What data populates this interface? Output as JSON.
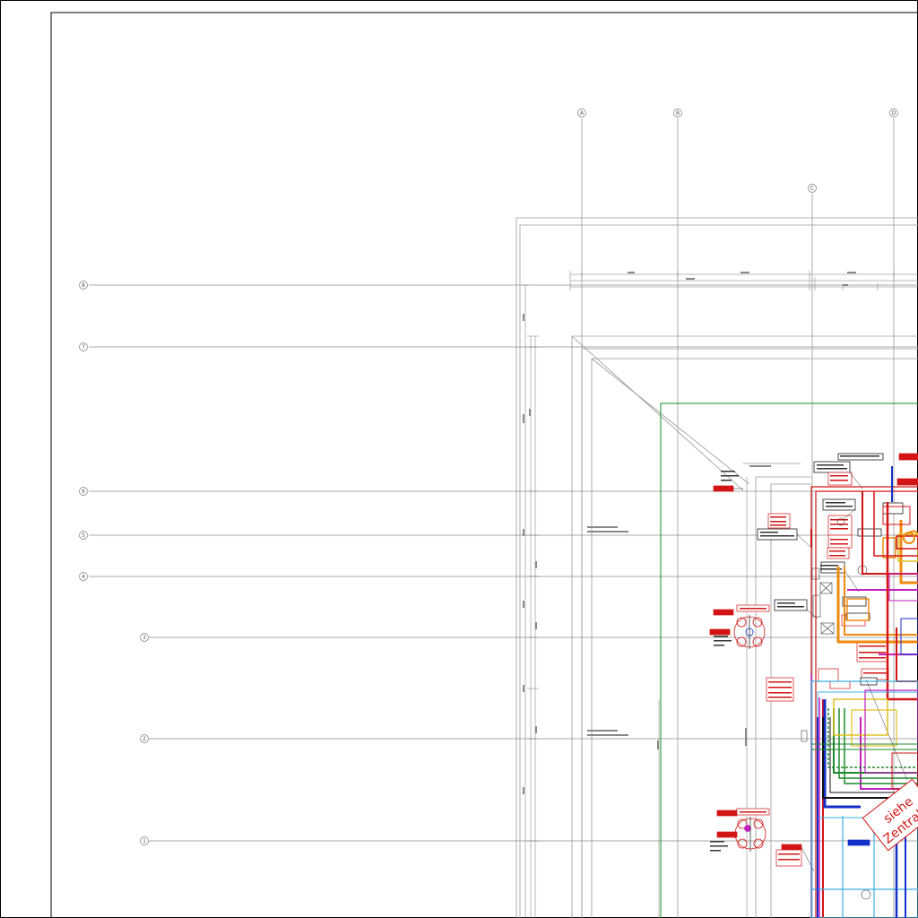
{
  "grid": {
    "vertical": [
      {
        "label": "A"
      },
      {
        "label": "B"
      },
      {
        "label": "C"
      },
      {
        "label": "D"
      }
    ],
    "horizontal": [
      {
        "label": "8"
      },
      {
        "label": "7"
      },
      {
        "label": "6"
      },
      {
        "label": "5"
      },
      {
        "label": "4"
      },
      {
        "label": "3"
      },
      {
        "label": "2"
      },
      {
        "label": "1"
      }
    ]
  },
  "notes": {
    "stamp_line1": "siehe",
    "stamp_line2": "Zentrale O"
  },
  "colors": {
    "grid": "#8c8c8c",
    "wall": "#9a9a9a",
    "red": "#d21414",
    "green": "#1a8a2a",
    "blue": "#1530c8",
    "magenta": "#c21fc2",
    "orange": "#f08a10",
    "cyan": "#3ab0e0",
    "yellow": "#e0c020"
  }
}
